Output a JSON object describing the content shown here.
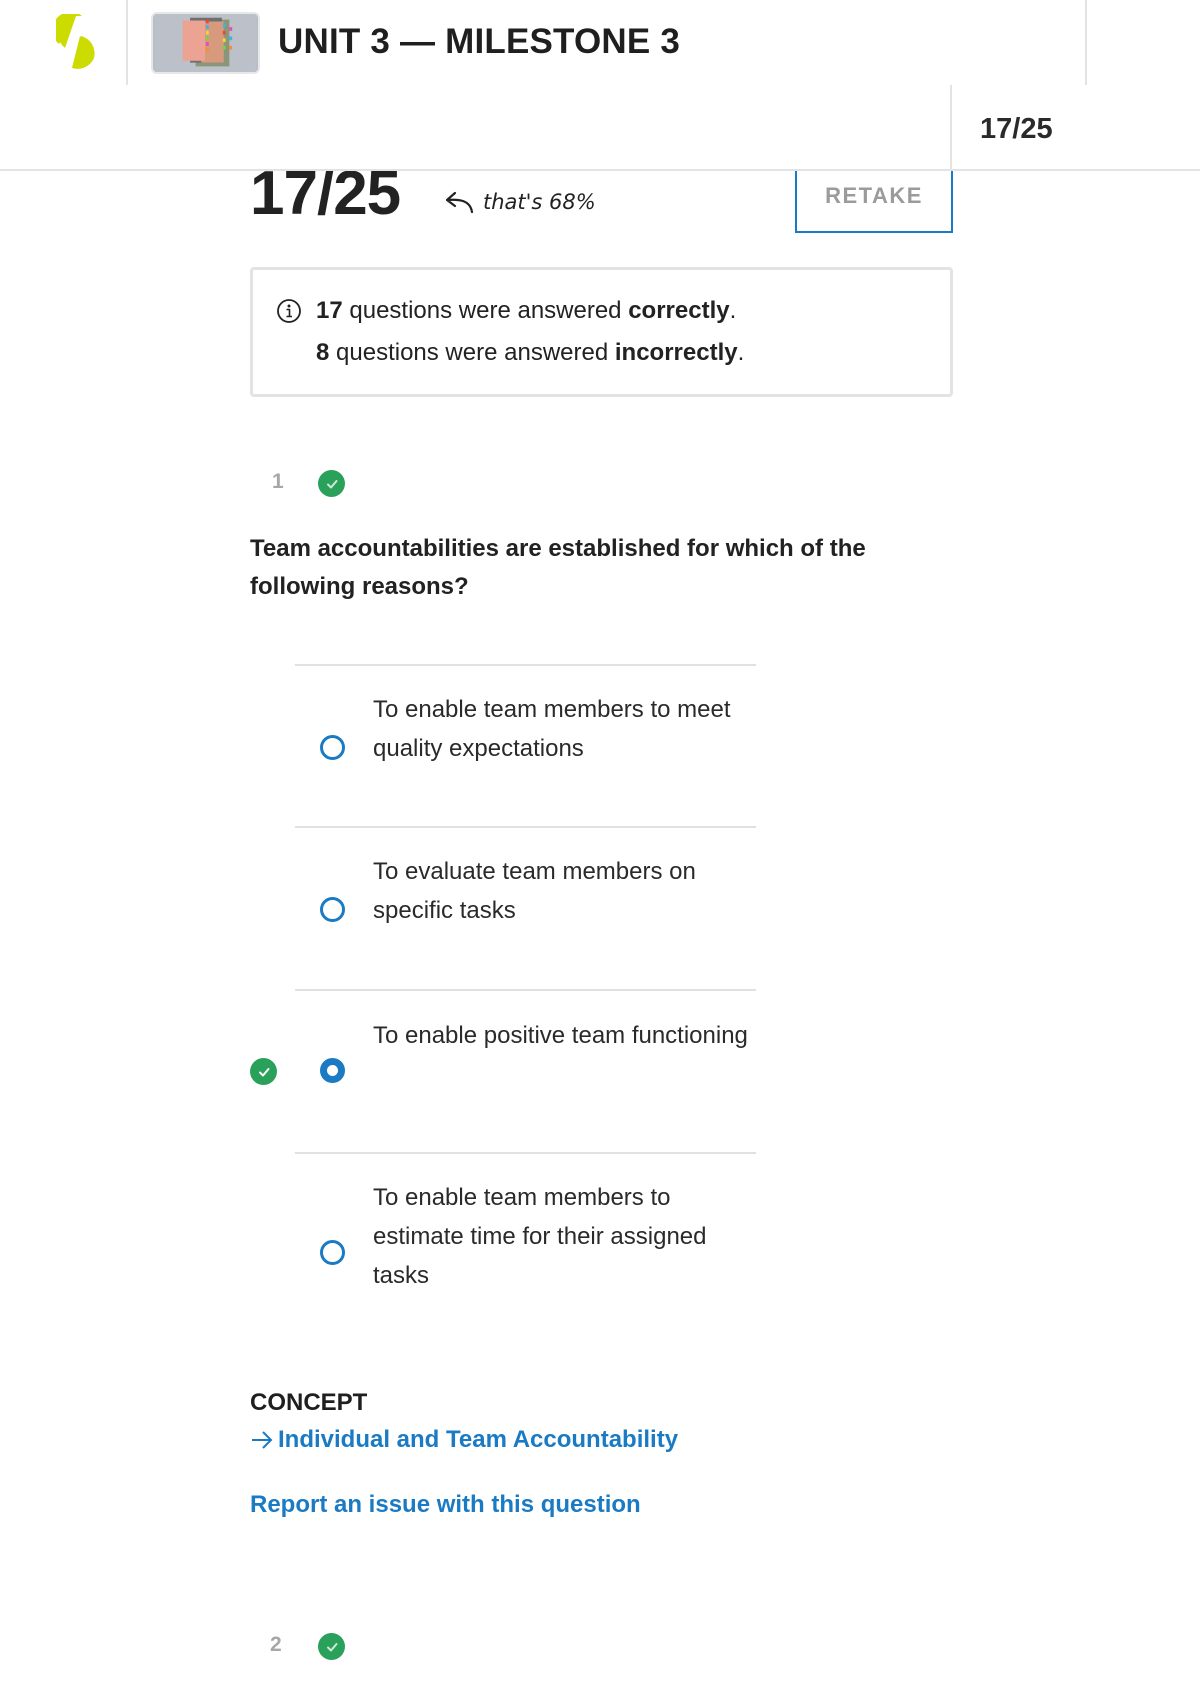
{
  "header": {
    "logo_icon": "sophia-logo-icon",
    "course_thumbnail": "course-thumbnail-folders",
    "title": "UNIT 3 — MILESTONE 3"
  },
  "subheader": {
    "score": "17/25"
  },
  "results": {
    "score": "17/25",
    "percent_note": "that's 68%",
    "retake_label": "RETAKE",
    "summary": {
      "correct_count": "17",
      "correct_text": " questions were answered ",
      "correct_word": "correctly",
      "incorrect_count": "8",
      "incorrect_text": " questions were answered ",
      "incorrect_word": "incorrectly",
      "period": "."
    }
  },
  "questions": [
    {
      "number": "1",
      "status": "correct",
      "text": "Team accountabilities are established for which of the following reasons?",
      "options": [
        {
          "label": "To enable team members to meet quality expectations",
          "selected": false,
          "correct": false
        },
        {
          "label": "To evaluate team members on specific tasks",
          "selected": false,
          "correct": false
        },
        {
          "label": "To enable positive team functioning",
          "selected": true,
          "correct": true
        },
        {
          "label": "To enable team members to estimate time for their assigned tasks",
          "selected": false,
          "correct": false
        }
      ],
      "concept_label": "CONCEPT",
      "concept_link": "Individual and Team Accountability",
      "report_link": "Report an issue with this question"
    },
    {
      "number": "2",
      "status": "correct"
    }
  ],
  "colors": {
    "accent_blue": "#1a7bc4",
    "correct_green": "#2aa15a",
    "logo_lime": "#cddc00"
  }
}
